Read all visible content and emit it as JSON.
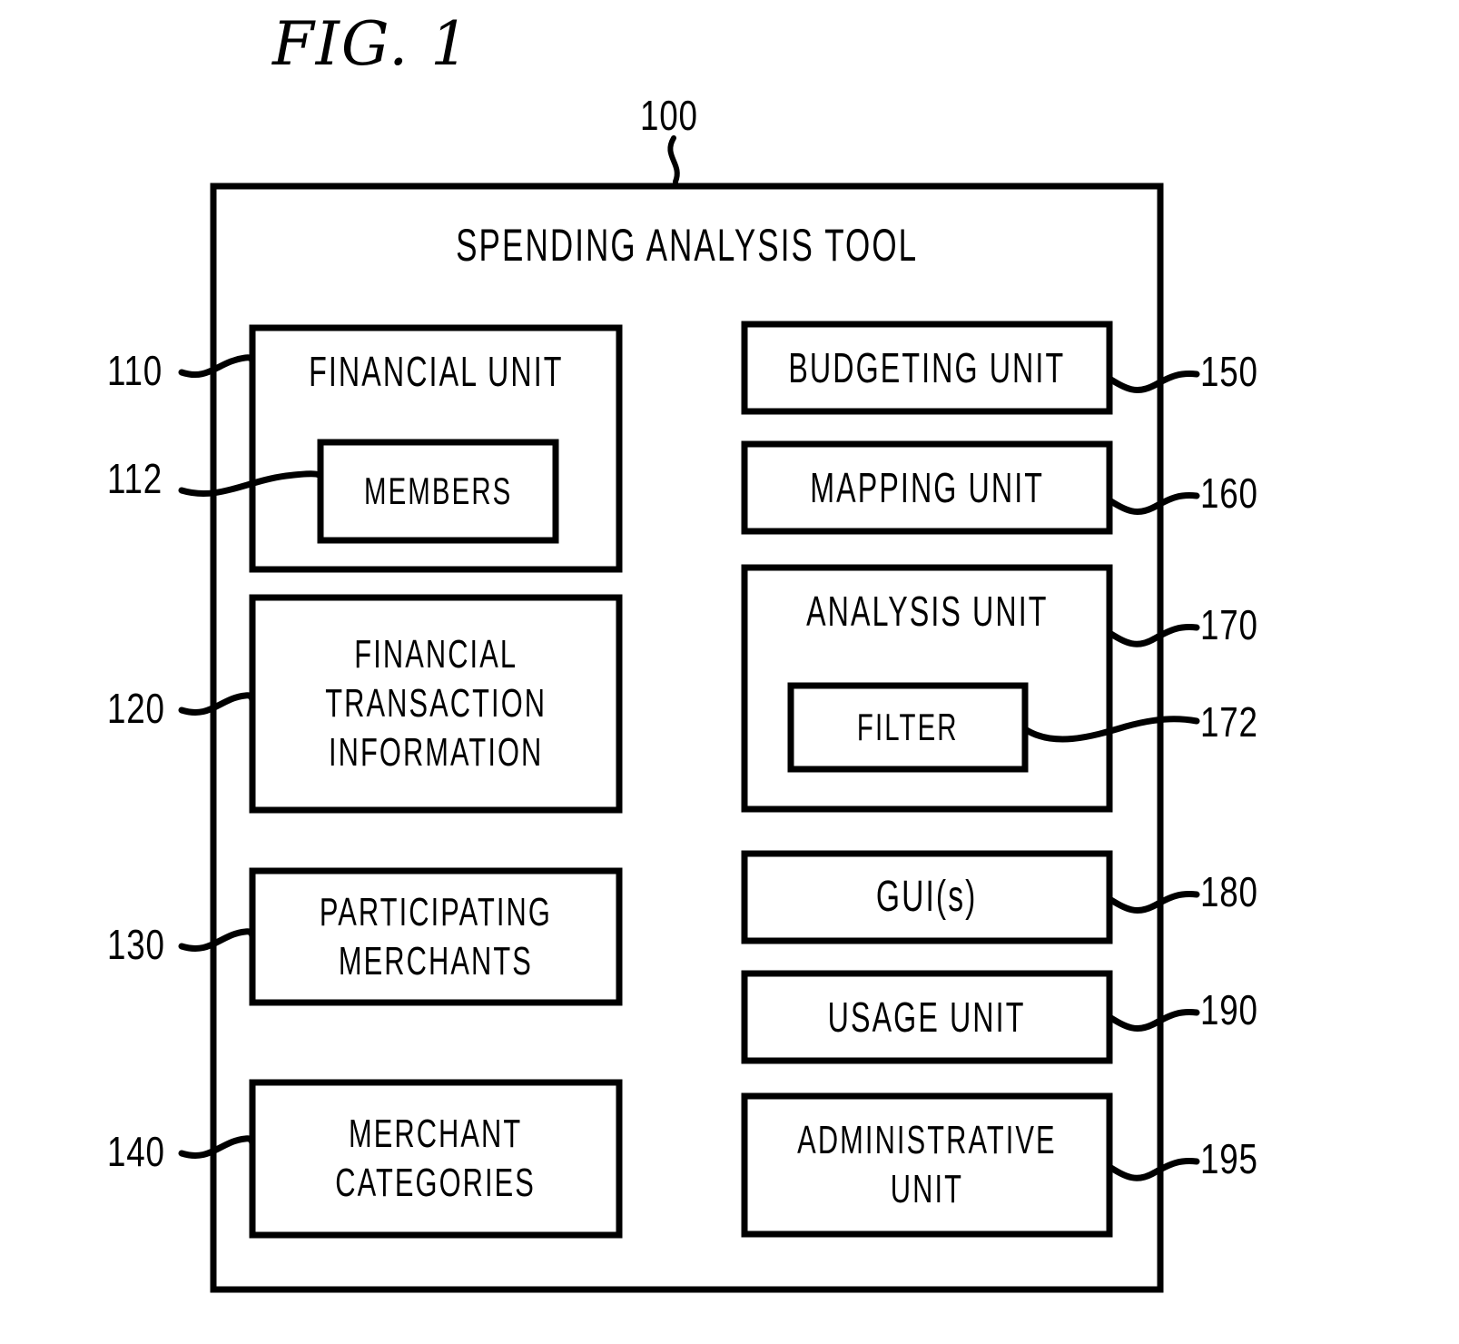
{
  "figure": {
    "title": "FIG. 1",
    "system_ref": "100",
    "system_title": "SPENDING ANALYSIS TOOL"
  },
  "left_column": [
    {
      "ref": "110",
      "label": "FINANCIAL UNIT",
      "child": {
        "ref": "112",
        "label": "MEMBERS"
      }
    },
    {
      "ref": "120",
      "label": "FINANCIAL\nTRANSACTION\nINFORMATION"
    },
    {
      "ref": "130",
      "label": "PARTICIPATING\nMERCHANTS"
    },
    {
      "ref": "140",
      "label": "MERCHANT\nCATEGORIES"
    }
  ],
  "right_column": [
    {
      "ref": "150",
      "label": "BUDGETING UNIT"
    },
    {
      "ref": "160",
      "label": "MAPPING UNIT"
    },
    {
      "ref": "170",
      "label": "ANALYSIS UNIT",
      "child": {
        "ref": "172",
        "label": "FILTER"
      }
    },
    {
      "ref": "180",
      "label": "GUI(s)"
    },
    {
      "ref": "190",
      "label": "USAGE UNIT"
    },
    {
      "ref": "195",
      "label": "ADMINISTRATIVE\nUNIT"
    }
  ],
  "colors": {
    "stroke": "#000000",
    "background": "#ffffff"
  }
}
